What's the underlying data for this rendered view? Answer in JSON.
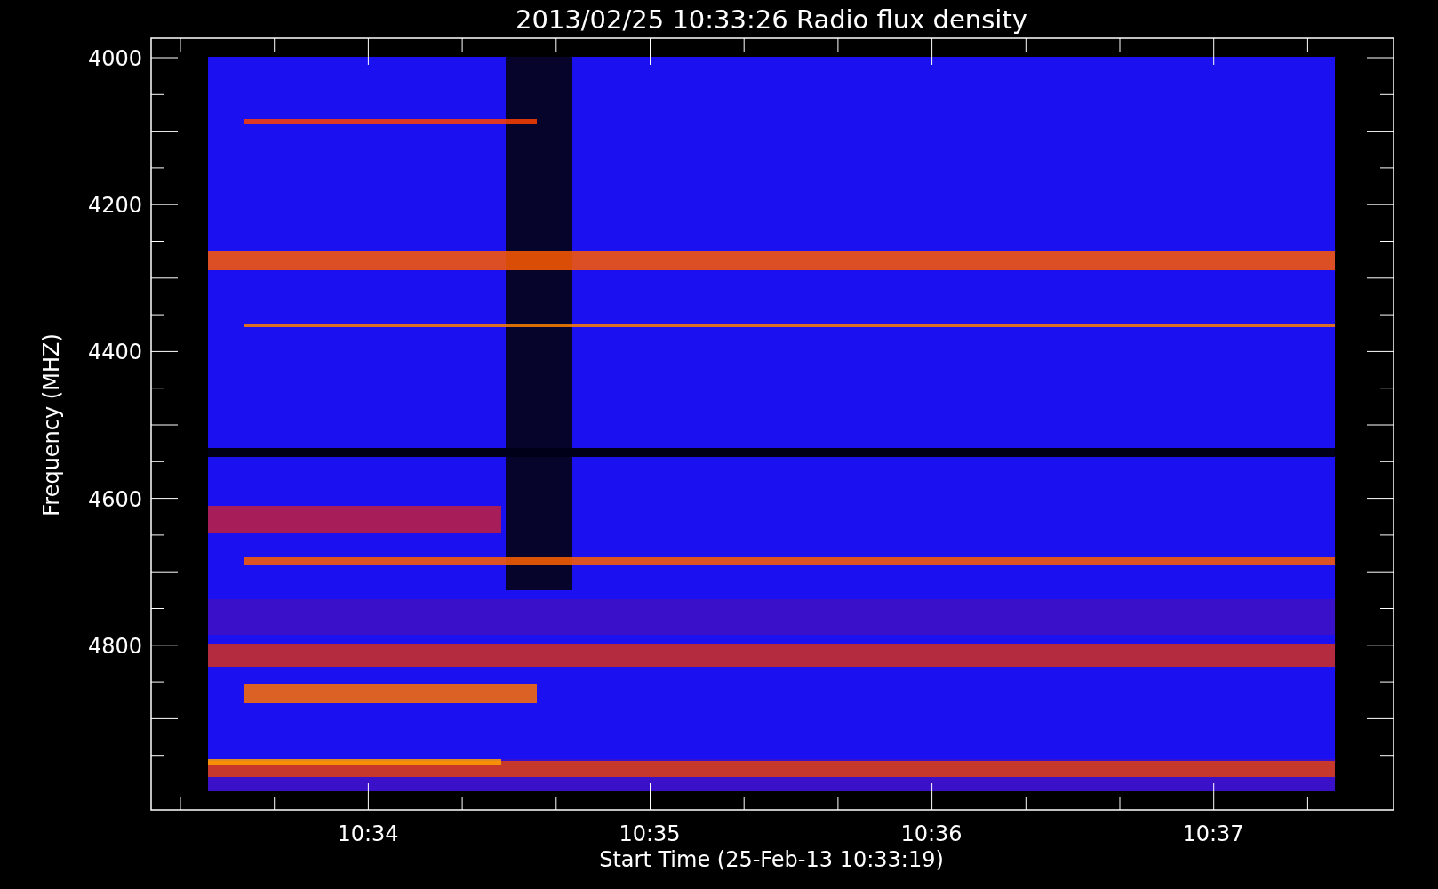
{
  "title": "2013/02/25 10:33:26 Radio flux density",
  "y_axis": {
    "label": "Frequency (MHZ)",
    "ticks": [
      "4000",
      "4200",
      "4400",
      "4600",
      "4800"
    ]
  },
  "x_axis": {
    "label": "Start Time (25-Feb-13 10:33:19)",
    "ticks": [
      "10:34",
      "10:35",
      "10:36",
      "10:37"
    ]
  }
}
